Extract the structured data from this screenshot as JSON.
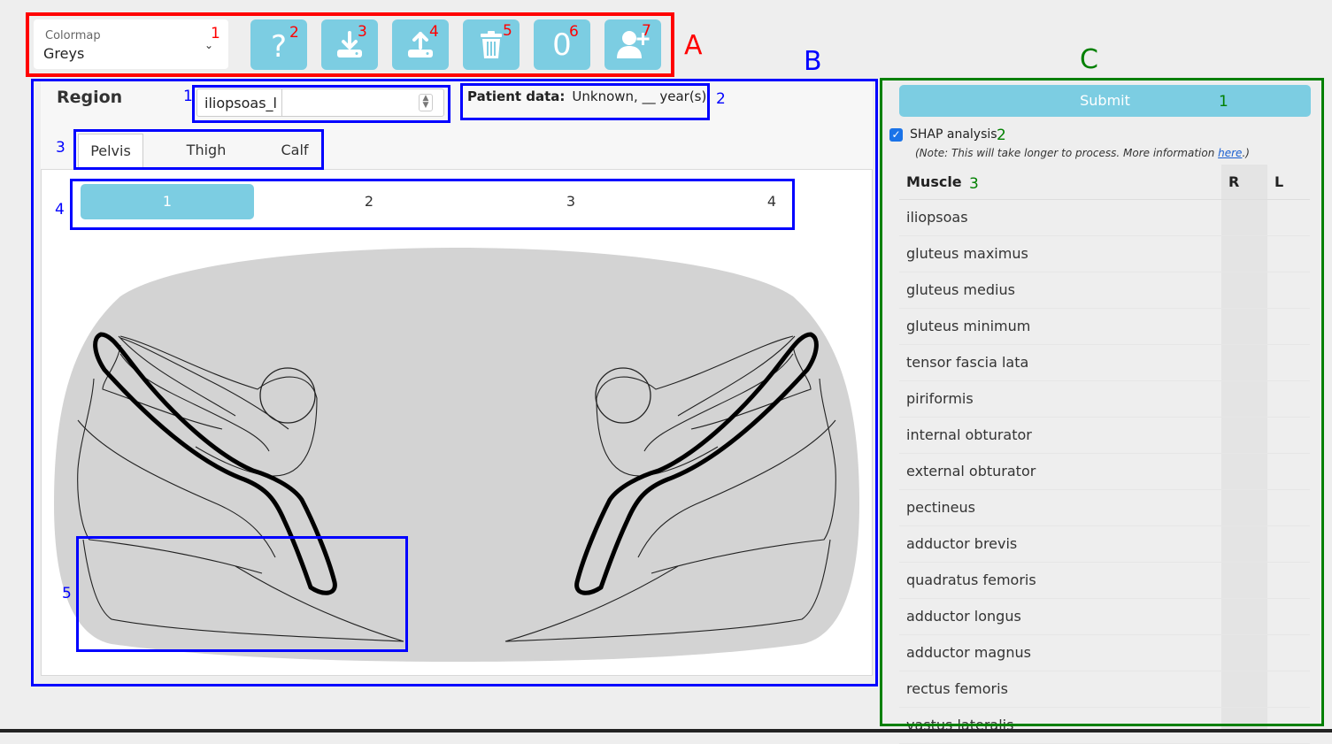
{
  "annotations": {
    "section_a": "A",
    "section_b": "B",
    "section_c": "C",
    "a_nums": [
      "1",
      "2",
      "3",
      "4",
      "5",
      "6",
      "7"
    ],
    "b_nums": [
      "1",
      "2",
      "3",
      "4",
      "5"
    ],
    "c_nums": [
      "1",
      "2",
      "3"
    ]
  },
  "toolbar": {
    "colormap_caption": "Colormap",
    "colormap_value": "Greys",
    "buttons": [
      {
        "icon": "help-icon"
      },
      {
        "icon": "download-icon"
      },
      {
        "icon": "upload-icon"
      },
      {
        "icon": "trash-icon"
      },
      {
        "icon": "zero-icon",
        "glyph": "0"
      },
      {
        "icon": "add-user-icon"
      }
    ]
  },
  "region": {
    "title": "Region",
    "input_value": "iliopsoas_l",
    "patient_label": "Patient data:",
    "patient_value": "Unknown, __ year(s)",
    "tabs": [
      "Pelvis",
      "Thigh",
      "Calf"
    ],
    "active_tab": "Pelvis",
    "pages": [
      "1",
      "2",
      "3",
      "4"
    ],
    "active_page": "1"
  },
  "analysis": {
    "submit_label": "Submit",
    "shap_label": "SHAP analysis",
    "shap_checked": true,
    "note_prefix": "(Note: This will take longer to process. More information ",
    "note_link": "here",
    "note_suffix": ".)",
    "col_muscle": "Muscle",
    "col_r": "R",
    "col_l": "L",
    "muscles": [
      "iliopsoas",
      "gluteus maximus",
      "gluteus medius",
      "gluteus minimum",
      "tensor fascia lata",
      "piriformis",
      "internal obturator",
      "external obturator",
      "pectineus",
      "adductor brevis",
      "quadratus femoris",
      "adductor longus",
      "adductor magnus",
      "rectus femoris",
      "vastus lateralis"
    ]
  },
  "colors": {
    "accent": "#7ccde2",
    "annotation_a": "#ff0000",
    "annotation_b": "#0000ff",
    "annotation_c": "#008000",
    "diagram_fill": "#d3d3d3"
  }
}
